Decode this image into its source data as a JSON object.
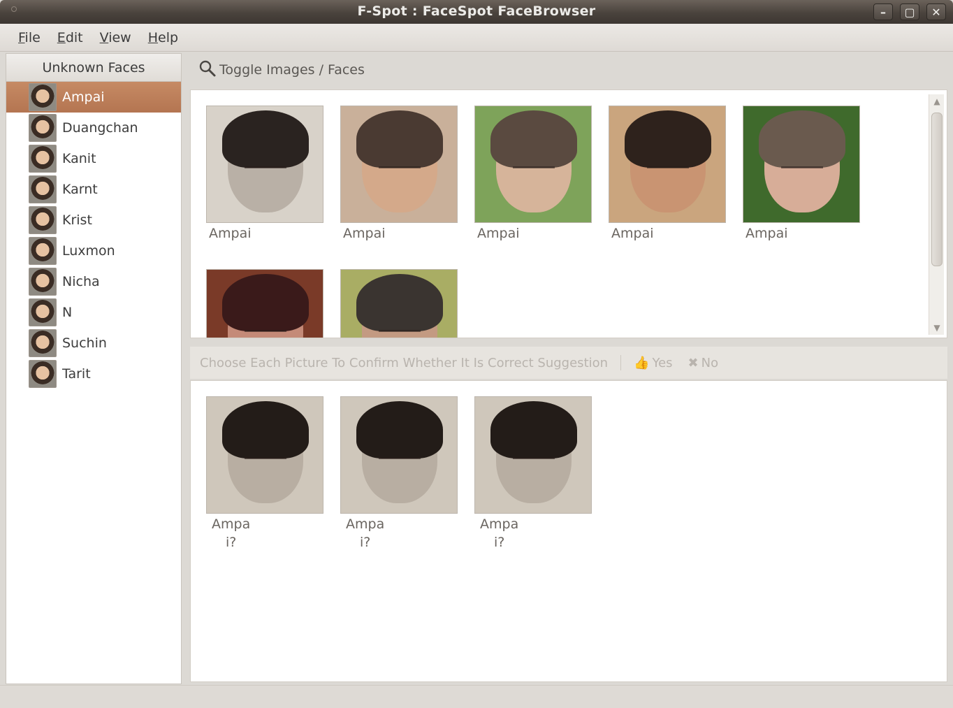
{
  "window": {
    "title": "F-Spot : FaceSpot FaceBrowser",
    "minimize_label": "–",
    "maximize_label": "▢",
    "close_label": "✕"
  },
  "menubar": {
    "file": {
      "u": "F",
      "rest": "ile"
    },
    "edit": {
      "u": "E",
      "rest": "dit"
    },
    "view": {
      "u": "V",
      "rest": "iew"
    },
    "help": {
      "u": "H",
      "rest": "elp"
    }
  },
  "sidebar": {
    "header": "Unknown Faces",
    "people": [
      {
        "label": "Ampai",
        "selected": true
      },
      {
        "label": "Duangchan"
      },
      {
        "label": "Kanit"
      },
      {
        "label": "Karnt"
      },
      {
        "label": "Krist"
      },
      {
        "label": "Luxmon"
      },
      {
        "label": "Nicha"
      },
      {
        "label": "N"
      },
      {
        "label": "Suchin"
      },
      {
        "label": "Tarit"
      }
    ]
  },
  "toolbar": {
    "toggle_label": "Toggle Images / Faces"
  },
  "faces": {
    "items": [
      {
        "caption": "Ampai"
      },
      {
        "caption": "Ampai"
      },
      {
        "caption": "Ampai"
      },
      {
        "caption": "Ampai"
      },
      {
        "caption": "Ampai"
      },
      {
        "caption": ""
      },
      {
        "caption": ""
      }
    ]
  },
  "confirm": {
    "prompt": "Choose Each Picture To Confirm Whether It Is Correct Suggestion",
    "yes_label": "Yes",
    "no_label": "No"
  },
  "suggestions": {
    "items": [
      {
        "caption": "Ampa",
        "caption2": "i?"
      },
      {
        "caption": "Ampa",
        "caption2": "i?"
      },
      {
        "caption": "Ampa",
        "caption2": "i?"
      }
    ]
  },
  "colors": {
    "selection": "#b97b57",
    "titlebar": "#4a433d"
  }
}
